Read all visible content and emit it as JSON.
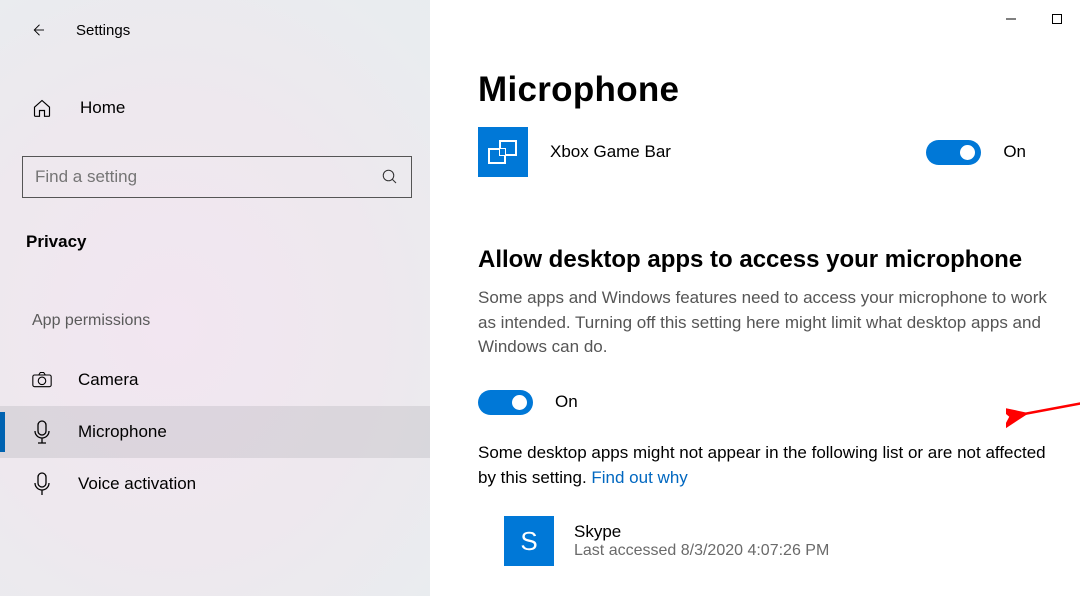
{
  "titlebar": {
    "app_title": "Settings"
  },
  "sidebar": {
    "home_label": "Home",
    "search_placeholder": "Find a setting",
    "category_label": "Privacy",
    "section_caption": "App permissions",
    "items": [
      {
        "label": "Camera",
        "icon": "camera-icon",
        "selected": false
      },
      {
        "label": "Microphone",
        "icon": "microphone-icon",
        "selected": true
      },
      {
        "label": "Voice activation",
        "icon": "voice-icon",
        "selected": false
      }
    ]
  },
  "main": {
    "page_heading": "Microphone",
    "app_entry": {
      "name": "Xbox Game Bar",
      "toggle_state_label": "On",
      "toggle_on": true
    },
    "section": {
      "heading": "Allow desktop apps to access your microphone",
      "description": "Some apps and Windows features need to access your microphone to work as intended. Turning off this setting here might limit what desktop apps and Windows can do.",
      "toggle_state_label": "On",
      "toggle_on": true,
      "note_prefix": "Some desktop apps might not appear in the following list or are not affected by this setting. ",
      "note_link": "Find out why"
    },
    "desktop_app": {
      "name": "Skype",
      "meta": "Last accessed 8/3/2020 4:07:26 PM",
      "initial": "S"
    }
  },
  "colors": {
    "accent": "#0078d7",
    "link": "#0067c0"
  }
}
